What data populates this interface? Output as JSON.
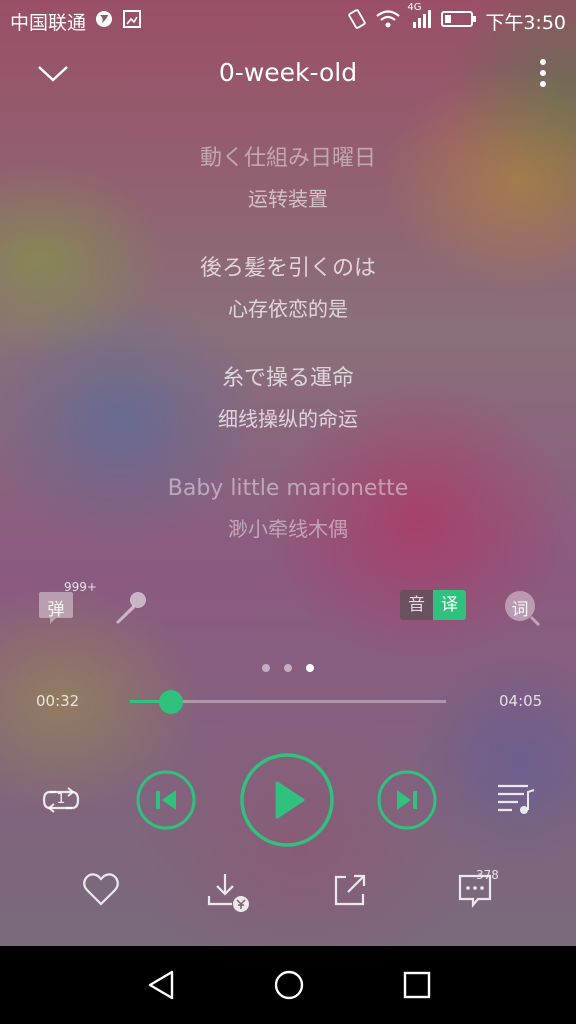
{
  "status_bar": {
    "carrier": "中国联通",
    "network": "4G",
    "time": "下午3:50"
  },
  "header": {
    "title": "0-week-old"
  },
  "lyrics": [
    {
      "original": "動く仕組み日曜日",
      "translation": "运转装置",
      "state": "dim"
    },
    {
      "original": "後ろ髪を引くのは",
      "translation": "心存依恋的是",
      "state": "normal"
    },
    {
      "original": "糸で操る運命",
      "translation": "细线操纵的命运",
      "state": "normal"
    },
    {
      "original": "Baby little marionette",
      "translation": "渺小牵线木偶",
      "state": "dim"
    }
  ],
  "tools": {
    "danmaku_label": "弹",
    "danmaku_count": "999+",
    "pronounce_label": "音",
    "translate_label": "译",
    "lyrics_search_label": "词"
  },
  "pager": {
    "count": 3,
    "active_index": 2
  },
  "progress": {
    "elapsed": "00:32",
    "duration": "04:05",
    "fraction": 0.1306
  },
  "playback": {
    "repeat_mode_badge": "1"
  },
  "bottom_actions": {
    "comments_count": "378"
  },
  "colors": {
    "accent": "#2ec27e",
    "accent_dark": "#1f9b5f"
  },
  "icons": [
    "chevron-down-icon",
    "more-vertical-icon",
    "microphone-icon",
    "lyrics-search-icon",
    "repeat-one-icon",
    "previous-icon",
    "play-icon",
    "next-icon",
    "playlist-icon",
    "heart-icon",
    "download-paid-icon",
    "share-icon",
    "comments-icon",
    "nav-back-icon",
    "nav-home-icon",
    "nav-recents-icon"
  ]
}
